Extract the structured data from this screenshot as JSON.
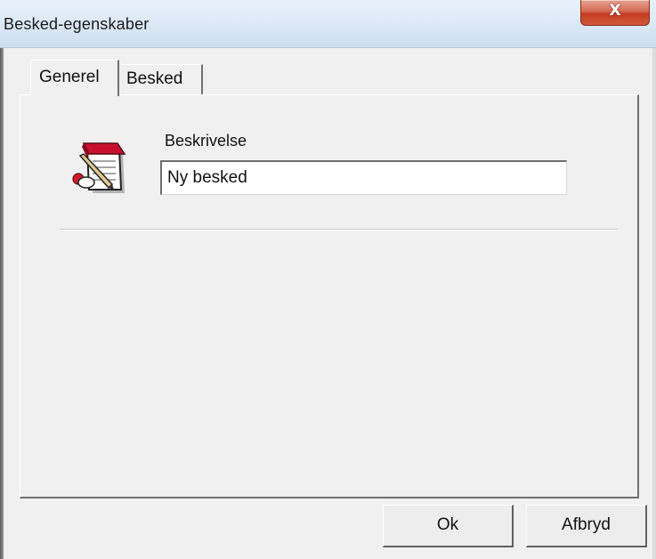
{
  "window": {
    "title": "Besked-egenskaber",
    "close_glyph": "X"
  },
  "tabs": [
    {
      "label": "Generel",
      "selected": true
    },
    {
      "label": "Besked",
      "selected": false
    }
  ],
  "general": {
    "description_label": "Beskrivelse",
    "description_value": "Ny besked",
    "icon": "notepad-pen-icon"
  },
  "buttons": {
    "ok_label": "Ok",
    "cancel_label": "Afbryd"
  },
  "colors": {
    "close_button": "#c43c22",
    "titlebar": "#dce9f6",
    "dialog_background": "#f0f0f0"
  }
}
